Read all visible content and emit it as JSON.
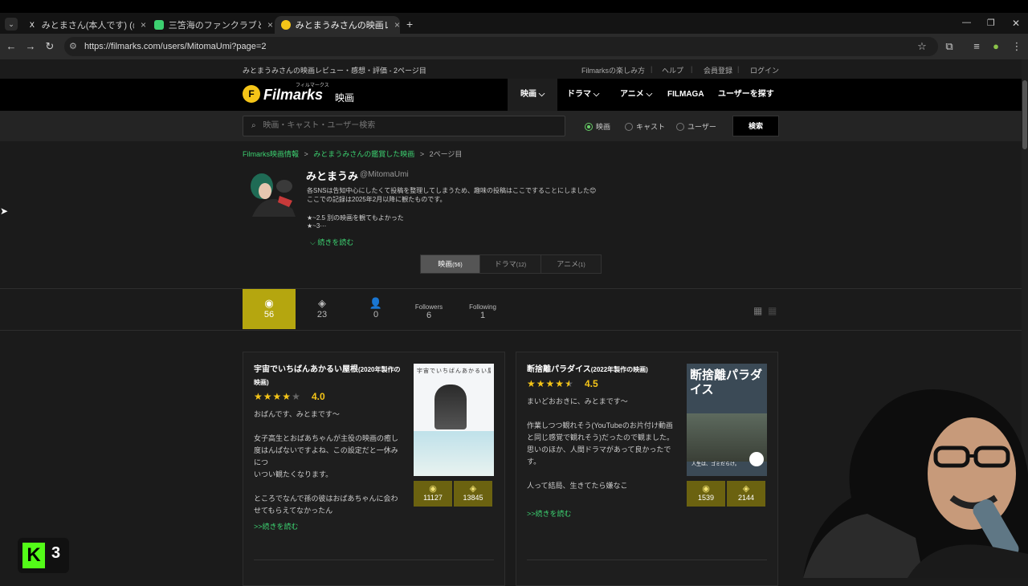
{
  "browser": {
    "tabs": [
      {
        "label": "みとまさん(本人です) (@UmiMit",
        "close": "×",
        "favicon": "X"
      },
      {
        "label": "三笘海のファンクラブとSNS - 三笘",
        "close": "×",
        "favicon": "■"
      },
      {
        "label": "みとまうみさんの映画レビュー・感想",
        "close": "×",
        "favicon": "●"
      }
    ],
    "new_tab": "+",
    "url": "https://filmarks.com/users/MitomaUmi?page=2"
  },
  "site": {
    "page_heading": "みとまうみさんの映画レビュー・感想・評価 - 2ページ目",
    "util_links": [
      "Filmarksの楽しみ方",
      "ヘルプ",
      "会員登録",
      "ログイン"
    ],
    "logo_text": "Filmarks",
    "logo_kana": "フィルマークス",
    "logo_suffix": "映画",
    "nav": [
      "映画",
      "ドラマ",
      "アニメ",
      "FILMAGA",
      "ユーザーを探す"
    ],
    "search_placeholder": "映画・キャスト・ユーザー検索",
    "search_options": [
      "映画",
      "キャスト",
      "ユーザー"
    ],
    "search_button": "検索"
  },
  "breadcrumb": {
    "items": [
      "Filmarks映画情報",
      "みとまうみさんの鑑賞した映画",
      "2ページ目"
    ],
    "sep": ">"
  },
  "profile": {
    "name": "みとまうみ",
    "handle": "@MitomaUmi",
    "bio_line1": "各SNSは告知中心にしたくて投稿を整理してしまうため、趣味の投稿はここですることにしました😊",
    "bio_line2": "ここでの記録は2025年2月以降に観たものです。",
    "bio_line3": "★~2.5 別の映画を観てもよかった",
    "bio_line4": "★~3⋯",
    "read_more": "続きを読む"
  },
  "segments": [
    {
      "label": "映画",
      "count": "(56)"
    },
    {
      "label": "ドラマ",
      "count": "(12)"
    },
    {
      "label": "アニメ",
      "count": "(1)"
    }
  ],
  "stats": [
    {
      "value": "56",
      "icon": "eye-icon"
    },
    {
      "value": "23",
      "icon": "clip-icon"
    },
    {
      "value": "0",
      "icon": "fan-icon"
    },
    {
      "label": "Followers",
      "value": "6"
    },
    {
      "label": "Following",
      "value": "1"
    }
  ],
  "reviews": [
    {
      "title": "宇宙でいちばんあかるい屋根",
      "year": "(2020年製作の映画)",
      "rating": 4.0,
      "rating_text": "4.0",
      "text": "おばんです、みとまです〜\n\n女子高生とおばあちゃんが主役の映画の癒し度はんぱないですよね、この設定だと一休みにつ\nいつい観たくなります。\n\nところでなんで孫の彼はおばあちゃんに会わせてもらえてなかったん",
      "read_more": ">>続きを読む",
      "marks": "11127",
      "clips": "13845",
      "poster_title": "宇宙でいちばんあかるい屋根"
    },
    {
      "title": "断捨離パラダイス",
      "year": "(2022年製作の映画)",
      "rating": 4.5,
      "rating_text": "4.5",
      "text": "まいどおおきに、みとまです〜\n\n作業しつつ観れそう(YouTubeのお片付け動画と同じ感覚で観れそう)だったので観ました。思いのほか、人間ドラマがあって良かったです。\n\n人って結局、生きてたら嫌なこ",
      "read_more": ">>続きを読む",
      "marks": "1539",
      "clips": "2144",
      "poster_title": "断捨離パラダイス",
      "poster_tagline": "人生は、ゴミだらけ。"
    }
  ],
  "overlay_badge": "3",
  "colors": {
    "accent": "#3cd070",
    "star": "#f5c518",
    "marks_bg": "#6b6210",
    "active_stat": "#b5a60f"
  }
}
